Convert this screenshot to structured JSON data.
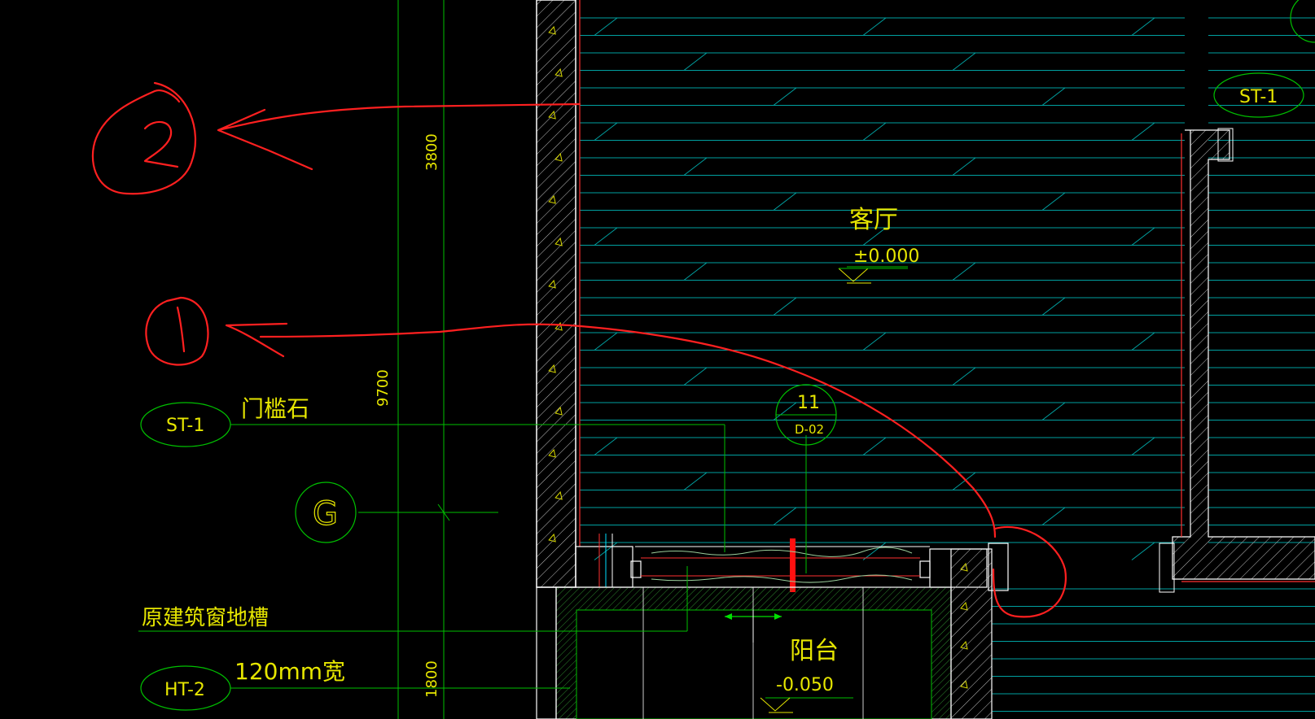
{
  "drawing": {
    "room_label": "客厅",
    "room_level": "±0.000",
    "balcony_label": "阳台",
    "balcony_level": "-0.050",
    "dim_3800": "3800",
    "dim_9700": "9700",
    "dim_1800": "1800",
    "grid_axis": "G",
    "tag_st1_left": "ST-1",
    "tag_st1_left_note": "门槛石",
    "tag_st1_right": "ST-1",
    "tag_ht2": "HT-2",
    "tag_ht2_note": "120mm宽",
    "note_window_slot": "原建筑窗地槽",
    "detail_number": "11",
    "detail_sheet": "D-02",
    "markup_1": "1",
    "markup_2": "2"
  },
  "colors": {
    "background": "#000000",
    "annotation_green": "#00cc00",
    "text_yellow": "#e6e600",
    "hatch_cyan": "#00b3b3",
    "wall_white": "#ffffff",
    "markup_red": "#ff2020"
  }
}
